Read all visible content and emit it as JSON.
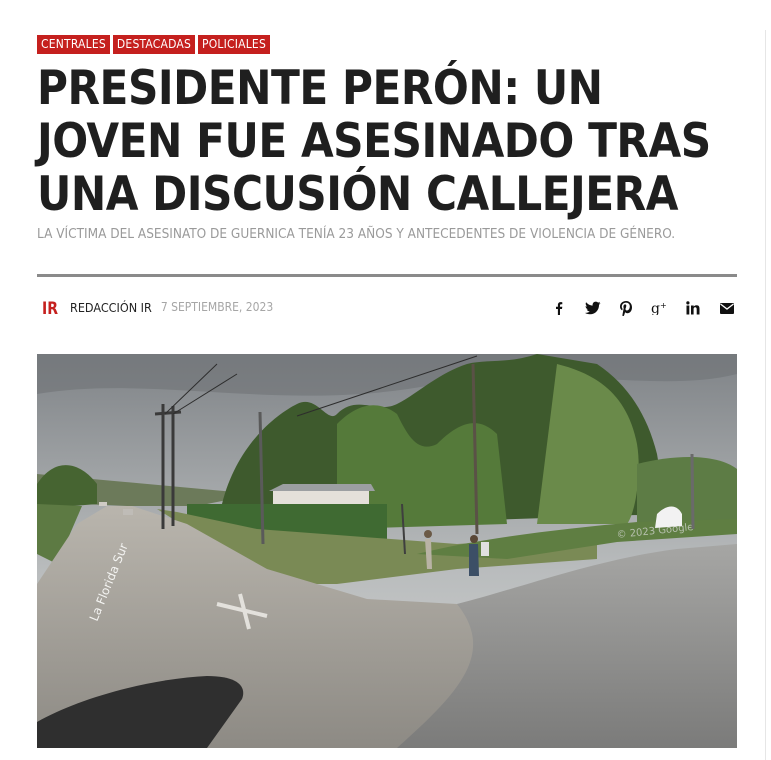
{
  "categories": [
    "Centrales",
    "Destacadas",
    "Policiales"
  ],
  "article": {
    "title": "PRESIDENTE PERÓN: UN JOVEN FUE ASESINADO TRAS UNA DISCUSIÓN CALLEJERA",
    "subtitle": "LA VÍCTIMA DEL ASESINATO DE GUERNICA TENÍA 23 AÑOS Y ANTECEDENTES DE VIOLENCIA DE GÉNERO.",
    "author": "REDACCIÓN IR",
    "date": "7 SEPTIEMBRE, 2023",
    "logo_text": "IR"
  },
  "share_icons": [
    "facebook-icon",
    "twitter-icon",
    "pinterest-icon",
    "google-plus-icon",
    "linkedin-icon",
    "email-icon"
  ],
  "photo": {
    "street_sign": "La Florida Sur",
    "watermark": "© 2023 Google"
  },
  "colors": {
    "accent": "#c5201e",
    "title": "#1f1f1f",
    "subtitle": "#9a9a9a",
    "divider": "#8a8a8a"
  }
}
